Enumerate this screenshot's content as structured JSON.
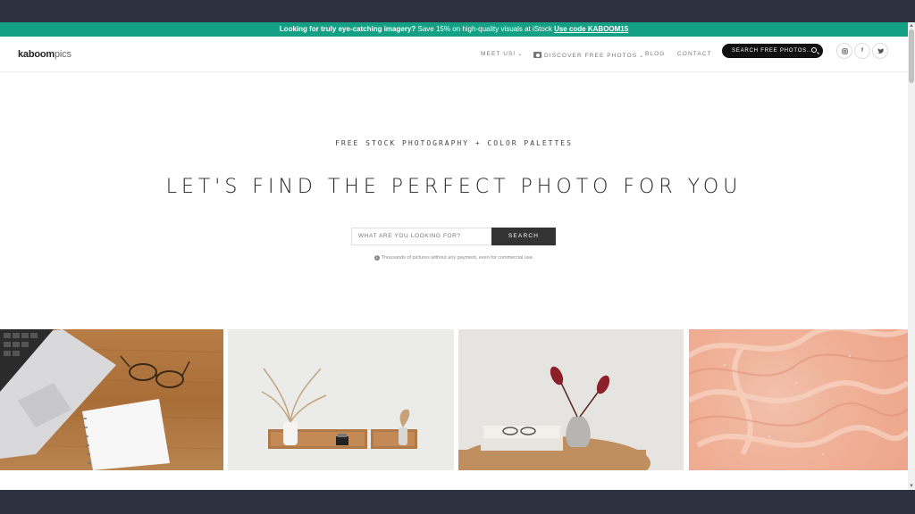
{
  "promo": {
    "lead": "Looking for truly eye-catching imagery?",
    "text": "Save 15% on high-quality visuals at iStock",
    "code_link": "Use code KABOOM15"
  },
  "header": {
    "logo_bold": "kaboom",
    "logo_light": "pics",
    "nav": {
      "meet": "MEET US!",
      "discover": "DISCOVER FREE PHOTOS",
      "blog": "BLOG",
      "contact": "CONTACT"
    },
    "search_label": "SEARCH FREE PHOTOS...",
    "social": [
      "instagram-icon",
      "facebook-icon",
      "twitter-icon"
    ]
  },
  "hero": {
    "subtitle": "FREE STOCK PHOTOGRAPHY + COLOR PALETTES",
    "title": "LET'S FIND THE PERFECT PHOTO FOR YOU",
    "search_placeholder": "WHAT ARE YOU LOOKING FOR?",
    "search_button": "SEARCH",
    "hint": "Thousands of pictures without any payment, even for commercial use."
  },
  "gallery": [
    "laptop-notebook-glasses-photo",
    "wall-shelf-vases-photo",
    "table-vase-books-photo",
    "pink-texture-photo"
  ],
  "colors": {
    "promo_bar": "#14a085",
    "frame": "#2e3240",
    "search_button": "#333333"
  }
}
